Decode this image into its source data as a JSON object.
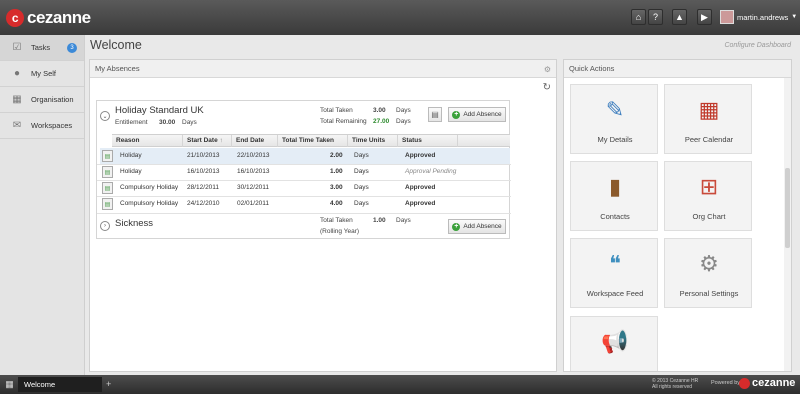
{
  "app": {
    "brand": "cezanne"
  },
  "header": {
    "icons": [
      "home-icon",
      "help-icon",
      "bell-icon",
      "play-icon"
    ],
    "icon_glyphs": [
      "⌂",
      "?",
      "▲",
      "▶"
    ],
    "user_name": "martin.andrews"
  },
  "sidebar": {
    "items": [
      {
        "label": "Tasks",
        "icon": "checkbox-icon",
        "glyph": "☑",
        "badge": "3"
      },
      {
        "label": "My Self",
        "icon": "person-icon",
        "glyph": "●"
      },
      {
        "label": "Organisation",
        "icon": "buildings-icon",
        "glyph": "▦"
      },
      {
        "label": "Workspaces",
        "icon": "chat-bubbles-icon",
        "glyph": "✉"
      }
    ]
  },
  "page": {
    "title": "Welcome",
    "configure": "Configure Dashboard"
  },
  "absences": {
    "panel_title": "My Absences",
    "holiday": {
      "title": "Holiday Standard UK",
      "entitlement_label": "Entitlement",
      "entitlement_value": "30.00",
      "entitlement_unit": "Days",
      "total_taken_label": "Total Taken",
      "total_taken_value": "3.00",
      "total_taken_unit": "Days",
      "total_remaining_label": "Total Remaining",
      "total_remaining_value": "27.00",
      "total_remaining_unit": "Days",
      "add_label": "Add Absence",
      "columns": [
        "Reason",
        "Start Date",
        "End Date",
        "Total Time Taken",
        "Time Units",
        "Status"
      ],
      "rows": [
        {
          "reason": "Holiday",
          "start": "21/10/2013",
          "end": "22/10/2013",
          "taken": "2.00",
          "units": "Days",
          "status": "Approved"
        },
        {
          "reason": "Holiday",
          "start": "16/10/2013",
          "end": "16/10/2013",
          "taken": "1.00",
          "units": "Days",
          "status": "Approval Pending"
        },
        {
          "reason": "Compulsory Holiday",
          "start": "28/12/2011",
          "end": "30/12/2011",
          "taken": "3.00",
          "units": "Days",
          "status": "Approved"
        },
        {
          "reason": "Compulsory Holiday",
          "start": "24/12/2010",
          "end": "02/01/2011",
          "taken": "4.00",
          "units": "Days",
          "status": "Approved"
        }
      ]
    },
    "sickness": {
      "title": "Sickness",
      "total_taken_label": "Total Taken",
      "total_taken_value": "1.00",
      "total_taken_unit": "Days",
      "period": "(Rolling Year)",
      "add_label": "Add Absence"
    }
  },
  "quick_actions": {
    "title": "Quick Actions",
    "tiles": [
      {
        "label": "My Details",
        "icon": "person-pen-icon",
        "glyph": "✎",
        "color": "#3f7fbf"
      },
      {
        "label": "Peer Calendar",
        "icon": "calendar-icon",
        "glyph": "▦",
        "color": "#c0392b"
      },
      {
        "label": "Contacts",
        "icon": "address-book-icon",
        "glyph": "▮",
        "color": "#8b5a2b"
      },
      {
        "label": "Org Chart",
        "icon": "org-chart-icon",
        "glyph": "⊞",
        "color": "#c94a3a"
      },
      {
        "label": "Workspace Feed",
        "icon": "speech-bubbles-icon",
        "glyph": "❝",
        "color": "#3f8fbf"
      },
      {
        "label": "Personal Settings",
        "icon": "gear-icon",
        "glyph": "⚙",
        "color": "#888888"
      },
      {
        "label": "",
        "icon": "megaphone-icon",
        "glyph": "📢",
        "color": "#c0392b"
      }
    ]
  },
  "taskbar": {
    "tab_label": "Welcome",
    "copyright_line1": "© 2013 Cezanne HR",
    "copyright_line2": "All rights reserved",
    "powered_by": "Powered by",
    "brand": "cezanne"
  }
}
